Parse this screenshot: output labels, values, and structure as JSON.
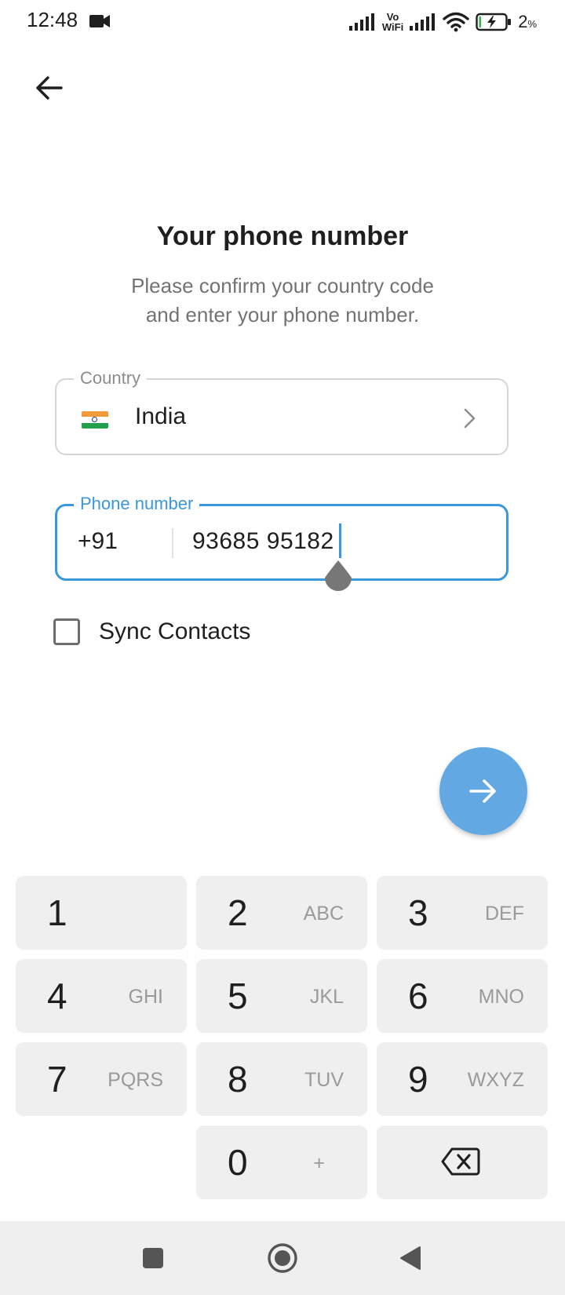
{
  "status_bar": {
    "time": "12:48",
    "vowifi_top": "Vo",
    "vowifi_bottom": "WiFi",
    "battery_percent": "2",
    "battery_percent_sign": "%",
    "icons": [
      "video-camera-icon",
      "signal-icon",
      "vowifi-icon",
      "signal-icon",
      "wifi-icon",
      "battery-charging-icon"
    ]
  },
  "header": {
    "title": "Your phone number",
    "subtitle": "Please confirm your country code\nand enter your phone number."
  },
  "country": {
    "label": "Country",
    "value": "India",
    "flag": "india-flag-icon"
  },
  "phone": {
    "label": "Phone number",
    "code": "+91",
    "number": "93685 95182",
    "accent_color": "#3a97d9"
  },
  "sync_contacts": {
    "label": "Sync Contacts",
    "checked": false
  },
  "fab": {
    "icon": "arrow-right-icon",
    "color": "#62a9e3"
  },
  "keypad": {
    "keys": [
      {
        "digit": "1",
        "letters": ""
      },
      {
        "digit": "2",
        "letters": "ABC"
      },
      {
        "digit": "3",
        "letters": "DEF"
      },
      {
        "digit": "4",
        "letters": "GHI"
      },
      {
        "digit": "5",
        "letters": "JKL"
      },
      {
        "digit": "6",
        "letters": "MNO"
      },
      {
        "digit": "7",
        "letters": "PQRS"
      },
      {
        "digit": "8",
        "letters": "TUV"
      },
      {
        "digit": "9",
        "letters": "WXYZ"
      },
      {
        "digit": "0",
        "letters": "+"
      }
    ],
    "backspace_icon": "backspace-icon"
  },
  "nav_bar": {
    "icons": [
      "recents-square-icon",
      "home-circle-icon",
      "back-triangle-icon"
    ]
  }
}
